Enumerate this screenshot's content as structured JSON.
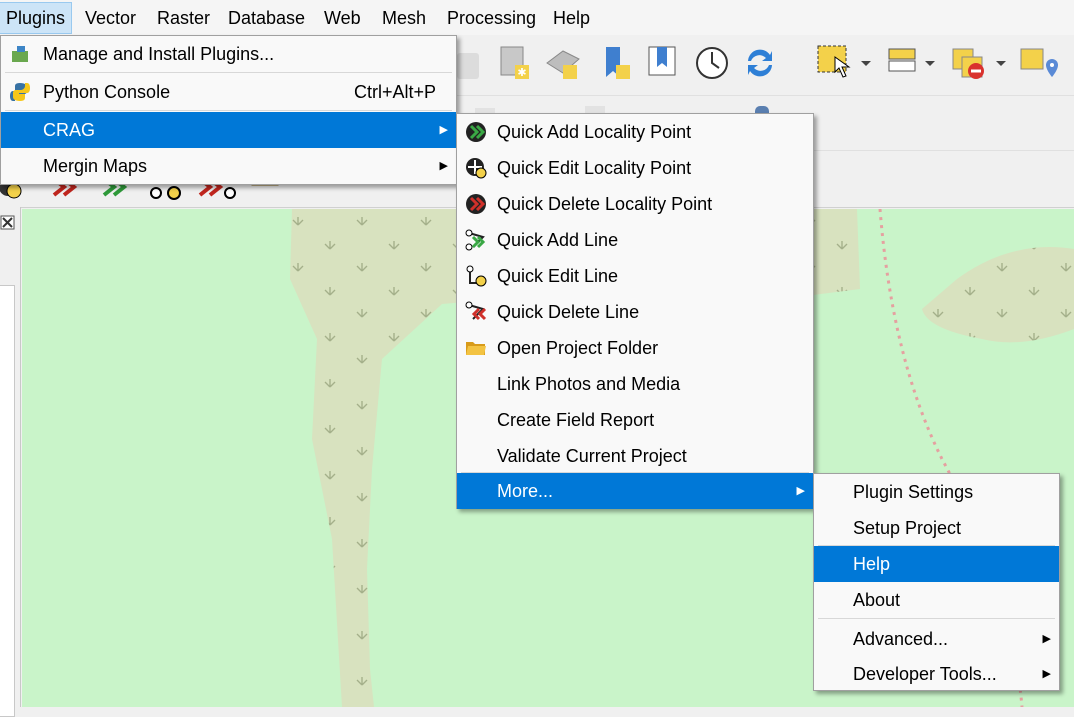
{
  "menubar": [
    "Plugins",
    "Vector",
    "Raster",
    "Database",
    "Web",
    "Mesh",
    "Processing",
    "Help"
  ],
  "plugins_menu": {
    "manage": "Manage and Install Plugins...",
    "python": "Python Console",
    "python_shortcut": "Ctrl+Alt+P",
    "crag": "CRAG",
    "mergin": "Mergin Maps"
  },
  "crag_menu": {
    "quick_add_point": "Quick Add Locality Point",
    "quick_edit_point": "Quick Edit Locality Point",
    "quick_delete_point": "Quick Delete Locality Point",
    "quick_add_line": "Quick Add Line",
    "quick_edit_line": "Quick Edit Line",
    "quick_delete_line": "Quick Delete Line",
    "open_folder": "Open Project Folder",
    "link_photos": "Link Photos and Media",
    "create_report": "Create Field Report",
    "validate": "Validate Current Project",
    "more": "More..."
  },
  "more_menu": {
    "plugin_settings": "Plugin Settings",
    "setup_project": "Setup Project",
    "help": "Help",
    "about": "About",
    "advanced": "Advanced...",
    "developer": "Developer Tools..."
  },
  "colors": {
    "highlight": "#0078d7",
    "map_green": "#c9f4c9",
    "forest": "#d8e2bf",
    "path": "#e5a0a0"
  }
}
